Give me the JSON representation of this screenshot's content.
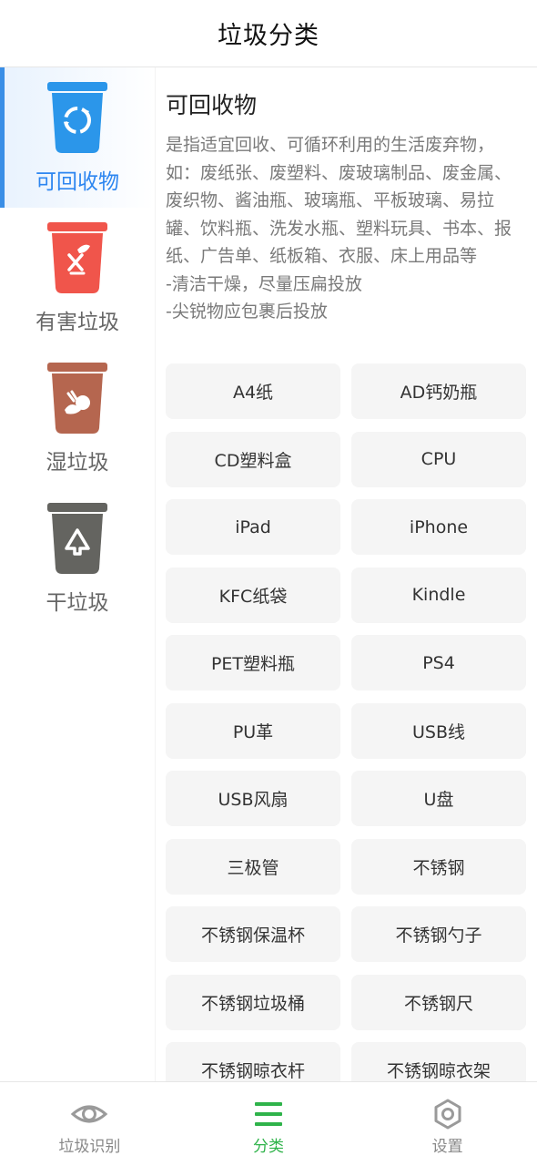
{
  "header": {
    "title": "垃圾分类"
  },
  "sidebar": {
    "items": [
      {
        "label": "可回收物",
        "icon": "recyclable-bin-icon",
        "color": "#2b96ea",
        "active": true
      },
      {
        "label": "有害垃圾",
        "icon": "hazardous-bin-icon",
        "color": "#f0554b",
        "active": false
      },
      {
        "label": "湿垃圾",
        "icon": "wet-bin-icon",
        "color": "#b5664f",
        "active": false
      },
      {
        "label": "干垃圾",
        "icon": "dry-bin-icon",
        "color": "#646460",
        "active": false
      }
    ]
  },
  "content": {
    "title": "可回收物",
    "description": "是指适宜回收、可循环利用的生活废弃物，如：废纸张、废塑料、废玻璃制品、废金属、废织物、酱油瓶、玻璃瓶、平板玻璃、易拉罐、饮料瓶、洗发水瓶、塑料玩具、书本、报纸、广告单、纸板箱、衣服、床上用品等",
    "tips": [
      "-清洁干燥，尽量压扁投放",
      "-尖锐物应包裹后投放"
    ],
    "items": [
      "A4纸",
      "AD钙奶瓶",
      "CD塑料盒",
      "CPU",
      "iPad",
      "iPhone",
      "KFC纸袋",
      "Kindle",
      "PET塑料瓶",
      "PS4",
      "PU革",
      "USB线",
      "USB风扇",
      "U盘",
      "三极管",
      "不锈钢",
      "不锈钢保温杯",
      "不锈钢勺子",
      "不锈钢垃圾桶",
      "不锈钢尺",
      "不锈钢晾衣杆",
      "不锈钢晾衣架"
    ]
  },
  "tabbar": {
    "items": [
      {
        "label": "垃圾识别",
        "icon": "eye-icon",
        "active": false
      },
      {
        "label": "分类",
        "icon": "menu-icon",
        "active": true
      },
      {
        "label": "设置",
        "icon": "settings-icon",
        "active": false
      }
    ],
    "active_color": "#2fb34a",
    "inactive_color": "#999999"
  }
}
